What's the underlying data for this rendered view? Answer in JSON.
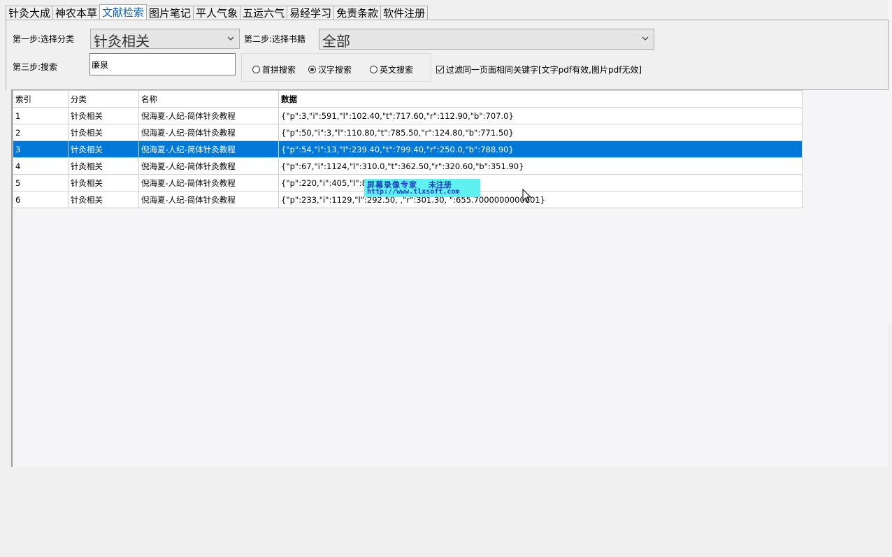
{
  "tabs": [
    "针灸大成",
    "神农本草",
    "文献检索",
    "图片笔记",
    "平人气象",
    "五运六气",
    "易经学习",
    "免责条款",
    "软件注册"
  ],
  "active_tab": 2,
  "step1": {
    "label": "第一步:选择分类",
    "value": "针灸相关"
  },
  "step2": {
    "label": "第二步:选择书籍",
    "value": "全部"
  },
  "step3": {
    "label": "第三步:搜索",
    "value": "廉泉"
  },
  "search_modes": {
    "pinyin": "首拼搜索",
    "hanzi": "汉字搜索",
    "english": "英文搜索",
    "selected": "hanzi"
  },
  "filter": {
    "checked": true,
    "label": "过滤同一页面相同关键字[文字pdf有效,图片pdf无效]"
  },
  "table": {
    "headers": [
      "索引",
      "分类",
      "名称",
      "数据"
    ],
    "rows": [
      [
        "1",
        "针灸相关",
        "倪海夏-人纪-简体针灸教程",
        "{\"p\":3,\"i\":591,\"l\":102.40,\"t\":717.60,\"r\":112.90,\"b\":707.0}"
      ],
      [
        "2",
        "针灸相关",
        "倪海夏-人纪-简体针灸教程",
        "{\"p\":50,\"i\":3,\"l\":110.80,\"t\":785.50,\"r\":124.80,\"b\":771.50}"
      ],
      [
        "3",
        "针灸相关",
        "倪海夏-人纪-简体针灸教程",
        "{\"p\":54,\"i\":13,\"l\":239.40,\"t\":799.40,\"r\":250.0,\"b\":788.90}"
      ],
      [
        "4",
        "针灸相关",
        "倪海夏-人纪-简体针灸教程",
        "{\"p\":67,\"i\":1124,\"l\":310.0,\"t\":362.50,\"r\":320.60,\"b\":351.90}"
      ],
      [
        "5",
        "针灸相关",
        "倪海夏-人纪-简体针灸教程",
        "{\"p\":220,\"i\":405,\"l\":81.                           69.50}"
      ],
      [
        "6",
        "针灸相关",
        "倪海夏-人纪-简体针灸教程",
        "{\"p\":233,\"i\":1129,\"l\":292.50,                    ,\"r\":301.30,   \":655.7000000000001}"
      ]
    ],
    "selected_row": 2
  },
  "watermark": {
    "line1": "屏幕录像专家",
    "line2": "未注册",
    "url": "http://www.tlxsoft.com"
  }
}
